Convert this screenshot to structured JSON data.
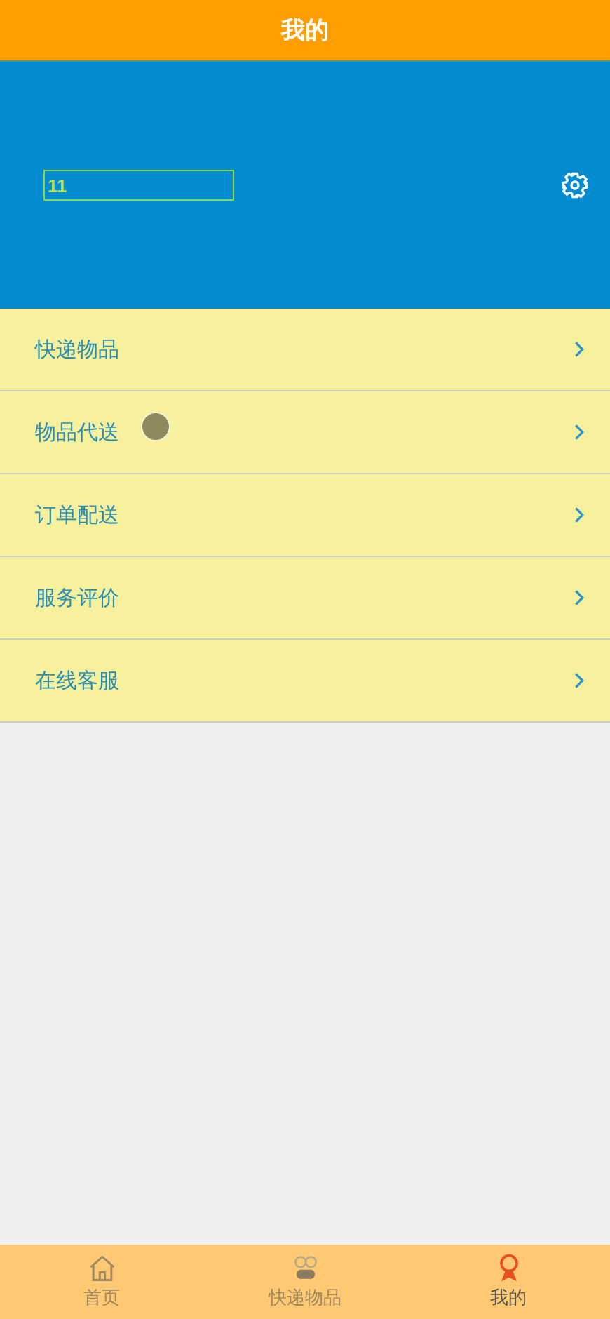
{
  "header": {
    "title": "我的"
  },
  "profile": {
    "name_field": {
      "value": "11"
    }
  },
  "menu": [
    {
      "label": "快递物品"
    },
    {
      "label": "物品代送"
    },
    {
      "label": "订单配送"
    },
    {
      "label": "服务评价"
    },
    {
      "label": "在线客服"
    }
  ],
  "tabbar": [
    {
      "label": "首页",
      "selected": false
    },
    {
      "label": "快递物品",
      "selected": false
    },
    {
      "label": "我的",
      "selected": true
    }
  ]
}
